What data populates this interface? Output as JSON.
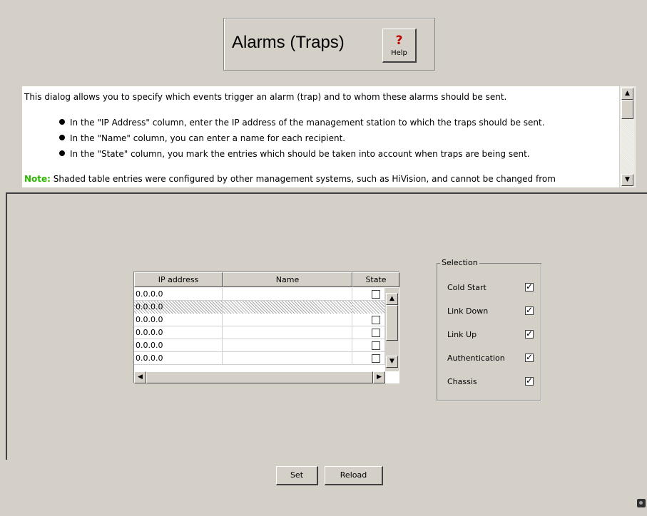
{
  "header": {
    "title": "Alarms (Traps)",
    "help_label": "Help",
    "help_icon": "?"
  },
  "description": {
    "intro": "This dialog allows you to specify which events trigger an alarm (trap) and to whom these alarms should be sent.",
    "bullets": [
      "In the \"IP Address\" column, enter the IP address of the management station to which the traps should be sent.",
      "In the \"Name\" column, you can enter a name for each recipient.",
      "In the \"State\" column, you mark the entries which should be taken into account when traps are being sent."
    ],
    "note_label": "Note:",
    "note_text": " Shaded table entries were configured by other management systems, such as HiVision, and cannot be changed from"
  },
  "table": {
    "columns": [
      "IP address",
      "Name",
      "State"
    ],
    "rows": [
      {
        "ip": "0.0.0.0",
        "name": "",
        "state": false,
        "shaded": false
      },
      {
        "ip": "0.0.0.0",
        "name": "",
        "state": false,
        "shaded": true
      },
      {
        "ip": "0.0.0.0",
        "name": "",
        "state": false,
        "shaded": false
      },
      {
        "ip": "0.0.0.0",
        "name": "",
        "state": false,
        "shaded": false
      },
      {
        "ip": "0.0.0.0",
        "name": "",
        "state": false,
        "shaded": false
      },
      {
        "ip": "0.0.0.0",
        "name": "",
        "state": false,
        "shaded": false
      }
    ]
  },
  "selection": {
    "legend": "Selection",
    "items": [
      {
        "label": "Cold Start",
        "checked": true
      },
      {
        "label": "Link Down",
        "checked": true
      },
      {
        "label": "Link Up",
        "checked": true
      },
      {
        "label": "Authentication",
        "checked": true
      },
      {
        "label": "Chassis",
        "checked": true
      }
    ]
  },
  "buttons": {
    "set": "Set",
    "reload": "Reload"
  }
}
